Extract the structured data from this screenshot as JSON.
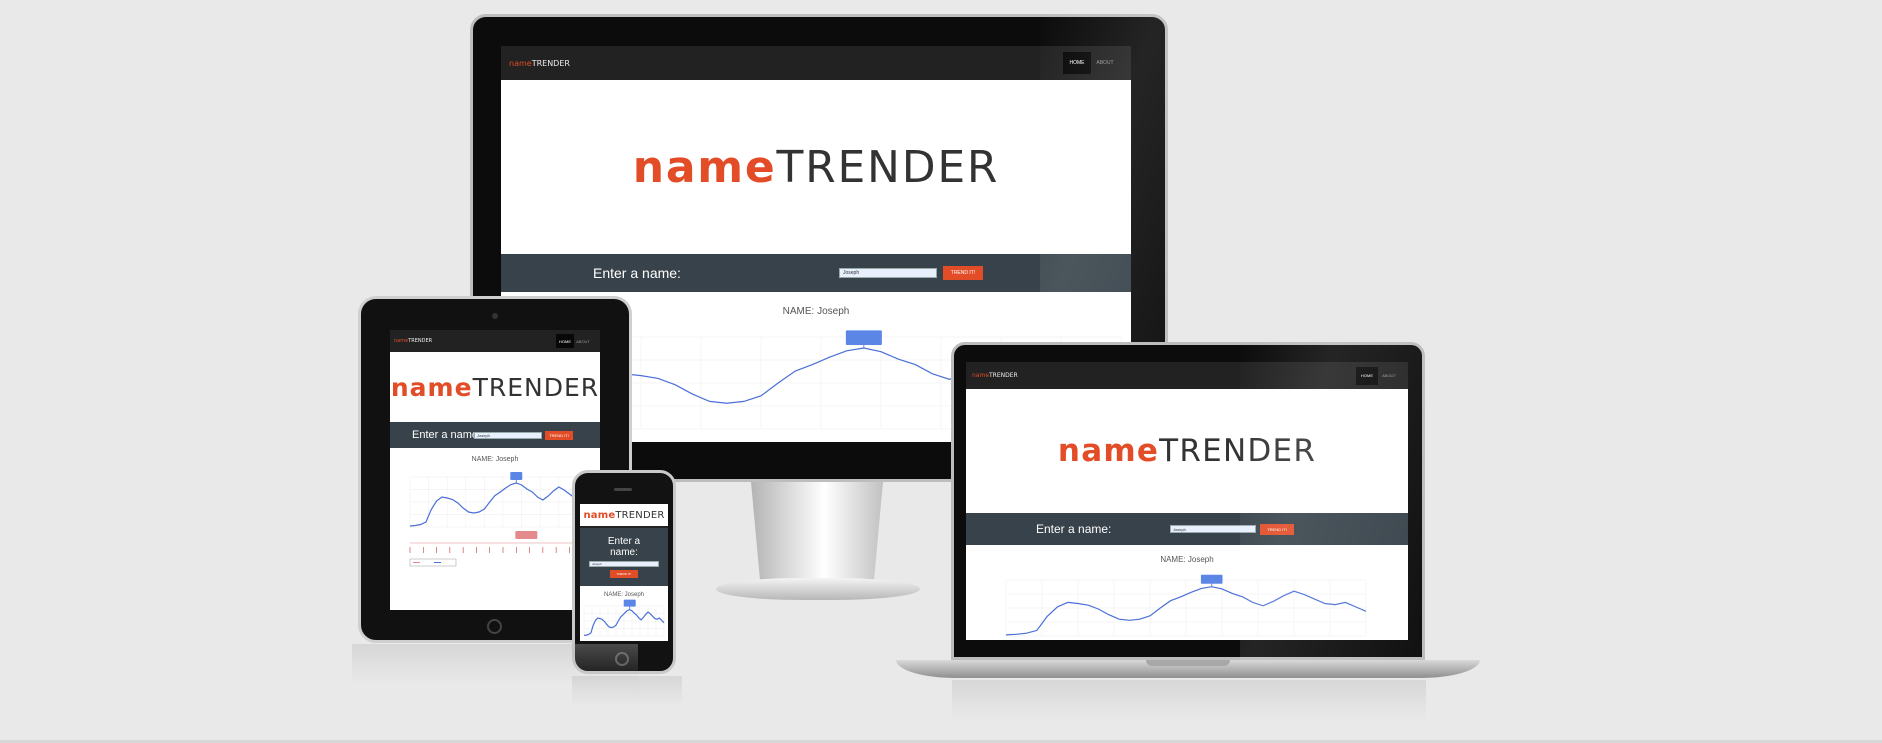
{
  "app": {
    "brand_name": "name",
    "brand_rest": "TRENDER",
    "nav": {
      "home": "HOME",
      "about": "ABOUT"
    },
    "hero_name": "name",
    "hero_rest": "TRENDER",
    "search_label": "Enter a name:",
    "search_label_mobile_1": "Enter a",
    "search_label_mobile_2": "name:",
    "search_value": "Joseph",
    "search_button": "TREND IT!",
    "chart_title": "NAME: Joseph"
  },
  "colors": {
    "accent": "#e24c27",
    "navbar": "#222222",
    "search_band": "#37424a",
    "line": "#4a6fd8",
    "background": "#e9e9e9"
  },
  "chart_data": {
    "type": "line",
    "title": "NAME: Joseph",
    "series": [
      {
        "values": [
          0.02,
          0.03,
          0.05,
          0.1,
          0.35,
          0.52,
          0.6,
          0.58,
          0.55,
          0.48,
          0.38,
          0.3,
          0.28,
          0.3,
          0.36,
          0.5,
          0.63,
          0.7,
          0.78,
          0.85,
          0.88,
          0.84,
          0.76,
          0.7,
          0.6,
          0.54,
          0.62,
          0.72,
          0.8,
          0.74,
          0.66,
          0.58,
          0.56,
          0.6,
          0.52,
          0.44
        ]
      }
    ]
  }
}
